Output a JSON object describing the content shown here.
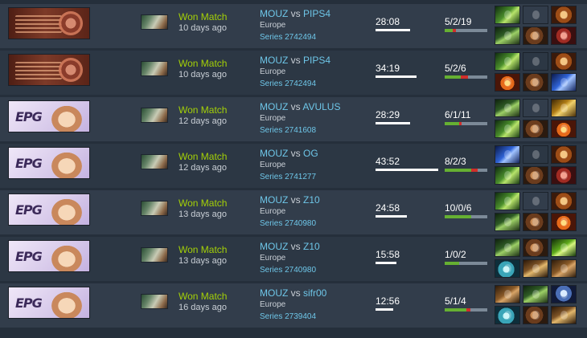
{
  "matches": [
    {
      "league": "ti",
      "league_text": "",
      "result": "Won Match",
      "when": "10 days ago",
      "team1": "MOUZ",
      "vs": "vs",
      "team2": "PIPS4",
      "region": "Europe",
      "series": "Series 2742494",
      "duration": "28:08",
      "duration_fraction": 0.55,
      "kda": "5/2/19",
      "kda_values": [
        5,
        2,
        19
      ],
      "items": [
        "green-item-icon",
        "pale-orb-item-icon",
        "amber-item-icon",
        "wand-item-icon",
        "boots-item-icon",
        "red-item-icon"
      ]
    },
    {
      "league": "ti",
      "league_text": "",
      "result": "Won Match",
      "when": "10 days ago",
      "team1": "MOUZ",
      "vs": "vs",
      "team2": "PIPS4",
      "region": "Europe",
      "series": "Series 2742494",
      "duration": "34:19",
      "duration_fraction": 0.66,
      "kda": "5/2/6",
      "kda_values": [
        5,
        2,
        6
      ],
      "items": [
        "green-item-icon",
        "pale-orb-item-icon",
        "amber-item-icon",
        "fire-item-icon",
        "boots-item-icon",
        "blue-item-icon"
      ]
    },
    {
      "league": "epg",
      "league_text": "EPG",
      "result": "Won Match",
      "when": "12 days ago",
      "team1": "MOUZ",
      "vs": "vs",
      "team2": "AVULUS",
      "region": "Europe",
      "series": "Series 2741608",
      "duration": "28:29",
      "duration_fraction": 0.55,
      "kda": "6/1/11",
      "kda_values": [
        6,
        1,
        11
      ],
      "items": [
        "wand-item-icon",
        "pale-orb-item-icon",
        "gold-item-icon",
        "green-item-icon",
        "boots-item-icon",
        "fire-item-icon"
      ]
    },
    {
      "league": "epg",
      "league_text": "EPG",
      "result": "Won Match",
      "when": "12 days ago",
      "team1": "MOUZ",
      "vs": "vs",
      "team2": "OG",
      "region": "Europe",
      "series": "Series 2741277",
      "duration": "43:52",
      "duration_fraction": 1.0,
      "kda": "8/2/3",
      "kda_values": [
        8,
        2,
        3
      ],
      "items": [
        "blue-item-icon",
        "pale-orb-item-icon",
        "amber-item-icon",
        "green-item-icon",
        "boots-item-icon",
        "red-item-icon"
      ]
    },
    {
      "league": "epg",
      "league_text": "EPG",
      "result": "Won Match",
      "when": "13 days ago",
      "team1": "MOUZ",
      "vs": "vs",
      "team2": "Z10",
      "region": "Europe",
      "series": "Series 2740980",
      "duration": "24:58",
      "duration_fraction": 0.5,
      "kda": "10/0/6",
      "kda_values": [
        10,
        0,
        6
      ],
      "items": [
        "green-item-icon",
        "pale-orb-item-icon",
        "amber-item-icon",
        "wand-item-icon",
        "boots-item-icon",
        "fire-item-icon"
      ]
    },
    {
      "league": "epg",
      "league_text": "EPG",
      "result": "Won Match",
      "when": "13 days ago",
      "team1": "MOUZ",
      "vs": "vs",
      "team2": "Z10",
      "region": "Europe",
      "series": "Series 2740980",
      "duration": "15:58",
      "duration_fraction": 0.33,
      "kda": "1/0/2",
      "kda_values": [
        1,
        0,
        2
      ],
      "items": [
        "wand-item-icon",
        "boots-item-icon",
        "lime-item-icon",
        "cyan-item-icon",
        "staff-item-icon",
        "bronze-item-icon"
      ]
    },
    {
      "league": "epg",
      "league_text": "EPG",
      "result": "Won Match",
      "when": "16 days ago",
      "team1": "MOUZ",
      "vs": "vs",
      "team2": "sifr00",
      "region": "Europe",
      "series": "Series 2739404",
      "duration": "12:56",
      "duration_fraction": 0.28,
      "kda": "5/1/4",
      "kda_values": [
        5,
        1,
        4
      ],
      "items": [
        "bronze-item-icon",
        "wand-item-icon",
        "moon-item-icon",
        "cyan-item-icon",
        "boots-item-icon",
        "staff-item-icon"
      ]
    }
  ]
}
